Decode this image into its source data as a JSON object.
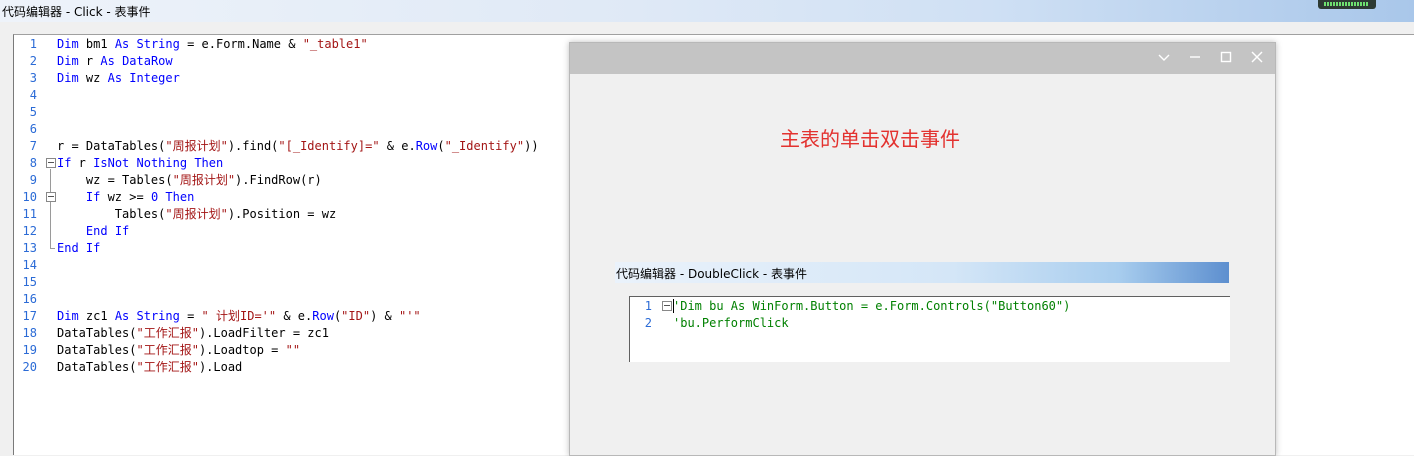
{
  "main_window": {
    "title": "代码编辑器 - Click - 表事件"
  },
  "editor": {
    "lines": [
      {
        "num": "1",
        "text": "Dim bm1 As String = e.Form.Name & \"_table1\""
      },
      {
        "num": "2",
        "text": "Dim r As DataRow"
      },
      {
        "num": "3",
        "text": "Dim wz As Integer"
      },
      {
        "num": "4",
        "text": ""
      },
      {
        "num": "5",
        "text": ""
      },
      {
        "num": "6",
        "text": ""
      },
      {
        "num": "7",
        "text": "r = DataTables(\"周报计划\").find(\"[_Identify]=\" & e.Row(\"_Identify\"))"
      },
      {
        "num": "8",
        "text": "If r IsNot Nothing Then"
      },
      {
        "num": "9",
        "text": "    wz = Tables(\"周报计划\").FindRow(r)"
      },
      {
        "num": "10",
        "text": "    If wz >= 0 Then"
      },
      {
        "num": "11",
        "text": "        Tables(\"周报计划\").Position = wz"
      },
      {
        "num": "12",
        "text": "    End If"
      },
      {
        "num": "13",
        "text": "End If"
      },
      {
        "num": "14",
        "text": ""
      },
      {
        "num": "15",
        "text": ""
      },
      {
        "num": "16",
        "text": ""
      },
      {
        "num": "17",
        "text": "Dim zc1 As String = \" 计划ID='\" & e.Row(\"ID\") & \"'\""
      },
      {
        "num": "18",
        "text": "DataTables(\"工作汇报\").LoadFilter = zc1"
      },
      {
        "num": "19",
        "text": "DataTables(\"工作汇报\").Loadtop = \"\""
      },
      {
        "num": "20",
        "text": "DataTables(\"工作汇报\").Load"
      }
    ]
  },
  "form_window": {
    "heading": "主表的单击双击事件",
    "buttons": {
      "dropdown": "chevron-down-icon",
      "minimize": "minimize-icon",
      "maximize": "maximize-icon",
      "close": "close-icon"
    }
  },
  "sub_window": {
    "title": "代码编辑器 - DoubleClick - 表事件",
    "lines": [
      {
        "num": "1",
        "text": "'Dim bu As WinForm.Button = e.Form.Controls(\"Button60\")"
      },
      {
        "num": "2",
        "text": "'bu.PerformClick"
      }
    ]
  },
  "colors": {
    "keyword": "#0000ff",
    "string": "#a31515",
    "comment": "#008000",
    "line_number": "#2b6bd6",
    "heading": "#e3322f"
  }
}
